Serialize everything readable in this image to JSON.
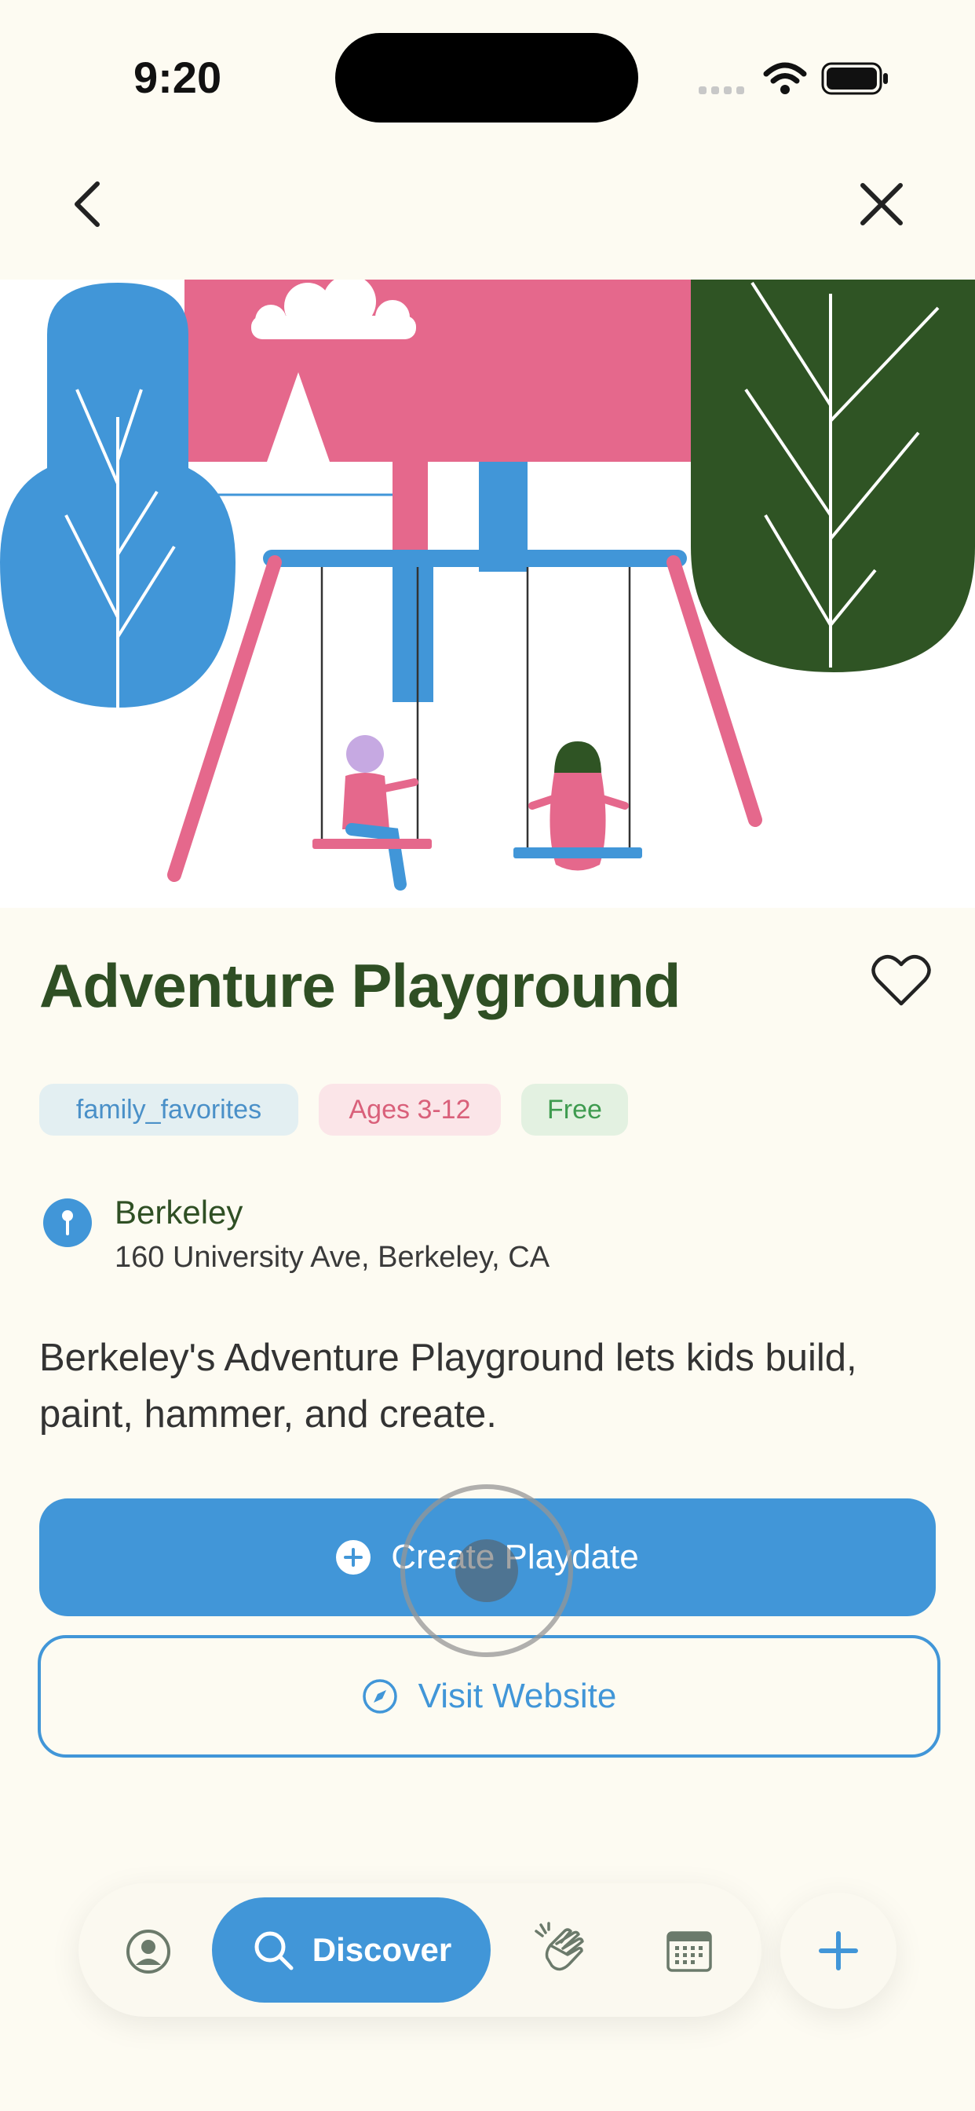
{
  "status_bar": {
    "time": "9:20"
  },
  "place": {
    "title": "Adventure Playground",
    "tags": [
      {
        "label": "family_favorites",
        "bg": "#E3EFF2",
        "fg": "#4A90C8"
      },
      {
        "label": "Ages 3-12",
        "bg": "#FBE5E8",
        "fg": "#D9607A"
      },
      {
        "label": "Free",
        "bg": "#E3F1E1",
        "fg": "#3E9B4F"
      }
    ],
    "location": {
      "name": "Berkeley",
      "address": "160 University Ave, Berkeley, CA"
    },
    "description": "Berkeley's Adventure Playground lets kids build, paint, hammer, and create."
  },
  "actions": {
    "create_playdate": "Create Playdate",
    "visit_website": "Visit Website"
  },
  "tab_bar": {
    "discover_label": "Discover",
    "icons": [
      "profile-icon",
      "search-icon",
      "clapping-hands-icon",
      "calendar-icon",
      "plus-icon"
    ]
  },
  "colors": {
    "background": "#FDFBF2",
    "accent_blue": "#4196D8",
    "title_green": "#2F4F24",
    "hero_pink": "#E5688C",
    "hero_dark_green": "#2F5424"
  }
}
